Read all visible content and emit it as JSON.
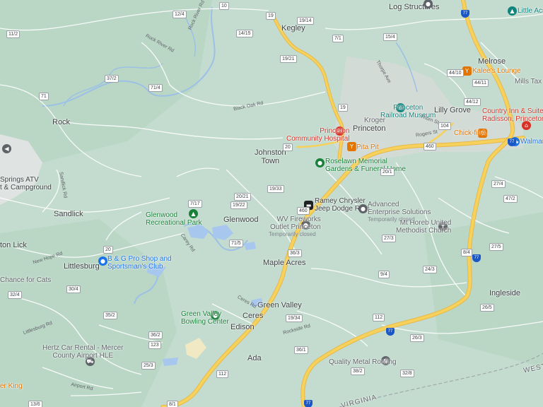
{
  "places": {
    "log_structures": "Log Structures",
    "little_acre": "Little Acre R",
    "kegley": "Kegley",
    "melrose": "Melrose",
    "rock": "Rock",
    "princeton": "Princeton",
    "lilly_grove": "Lilly Grove",
    "johnston_town": "Johnston\nTown",
    "sandlick": "Sandlick",
    "glenwood": "Glenwood",
    "maple_acres": "Maple Acres",
    "green_valley": "Green Valley",
    "ceres": "Ceres",
    "edison": "Edison",
    "ada": "Ada",
    "ingleside": "Ingleside",
    "littlesburg": "Littlesburg",
    "lick": "ton Lick"
  },
  "pois": {
    "princeton_railroad_museum": "Princeton\nRailroad Museum",
    "kroger": "Kroger",
    "princeton_community_hospital": "Princeton\nCommunity Hospital",
    "pita_pit": "Pita Pit",
    "kalees_lounge": "Kalee's Lounge",
    "mills_tax": "Mills Tax Serv",
    "country_inn": "Country Inn & Suites by\nRadisson, Princeton, WV",
    "chick_fil_a": "Chick-fil-A",
    "walmart": "Walmart S",
    "rosealawn": "Roselawn Memorial\nGardens & Funeral Home",
    "ramey": "Ramey Chrysler\nJeep Dodge Ram",
    "advanced_enterprise": "Advanced\nEnterprise Solutions",
    "advanced_enterprise_sub": "Temporarily closed",
    "wv_fireworks": "WV Fireworks\nOutlet Princeton",
    "wv_fireworks_sub": "Temporarily closed",
    "mt_horeb": "Mt Horeb United\nMethodist Church",
    "glenwood_park": "Glenwood\nRecreational Park",
    "springs_atv": "Springs ATV\nt & Campground",
    "bg_pro_shop": "B & G Pro Shop and\nSportsman's Club",
    "second_chance": "Chance for Cats",
    "green_valley_bowling": "Green Valley\nBowling Center",
    "hertz": "Hertz Car Rental - Mercer\nCounty Airport HLE",
    "quality_metal": "Quality Metal Roofing",
    "burger_king": "er King"
  },
  "roads": {
    "black_oak_rd": "Black Oak Rd",
    "rock_river_rd": "Rock River Rd",
    "thorn_st": "Thorn St",
    "rogers_st": "Rogers St",
    "thorpe_ave": "Thorpe Ave",
    "new_hope_rd": "New Hope Rd",
    "airport_rd": "Airport Rd",
    "carey_rd": "Carey Rd",
    "sandlick_rd": "Sandlick Rd",
    "littlesburg_rd": "Littlesburg Rd",
    "rock_river_rd2": "Rock River Rd",
    "ceres_rd": "Ceres Rd",
    "rockside_rd": "Rockside Rd",
    "west_virginia": "WEST V",
    "virginia_state": "VIRGINIA"
  },
  "shields": {
    "s19_top": "19",
    "s12_4": "12/4",
    "s10": "10",
    "s11_2": "11/2",
    "s19_14": "19/14",
    "s14_15": "14/15",
    "s15_4": "15/4",
    "s7_1": "7/1",
    "s19_21": "19/21",
    "s71_4": "71/4",
    "s19": "19",
    "s20": "20",
    "s71": "71",
    "s44_10": "44/10",
    "s44_11": "44/11",
    "s44_12": "44/12",
    "s104": "104",
    "s460": "460",
    "s20_1": "20/1",
    "s27_4": "27/4",
    "s47_2": "47/2",
    "s19_33": "19/33",
    "s20_21": "20/21",
    "s19_22": "19/22",
    "s7_17": "7/17",
    "s71_5": "71/5",
    "s27_3": "27/3",
    "s27_5": "27/5",
    "s8_4": "8/4",
    "s9_4": "9/4",
    "s24_3": "24/3",
    "s26_5": "26/5",
    "s19_34": "19/34",
    "s112": "112",
    "s112b": "112",
    "s36_1": "36/1",
    "s38_2": "38/2",
    "s26_3": "26/3",
    "s35_2": "35/2",
    "s36_2": "36/2",
    "s20b": "20",
    "s30_4": "30/4",
    "s32_7": "32/4",
    "s25_3": "25/3",
    "s123": "123",
    "s32_8": "32/8",
    "s13_6": "13/6",
    "s8_1": "8/1",
    "s37_2": "37/2",
    "s36_3": "36/3",
    "s460b": "460",
    "i77a": "77",
    "i77b": "77",
    "i77c": "77",
    "i77d": "77",
    "i77e": "77"
  },
  "colors": {
    "land": "#c3dccf",
    "forest": "#b4d3c1",
    "water": "#a7c7ee",
    "urban": "#d6dcd8",
    "highway": "#f6d25c",
    "highway_casing": "#e7b84a",
    "minor_road": "#ffffff",
    "state_border": "#9aa0a6",
    "poi_teal": "#12847e",
    "poi_green": "#188038",
    "poi_red": "#d93025",
    "poi_orange": "#e37400",
    "poi_blue": "#1a73e8",
    "poi_gray": "#5f6368",
    "interstate": "#1a56c4"
  }
}
